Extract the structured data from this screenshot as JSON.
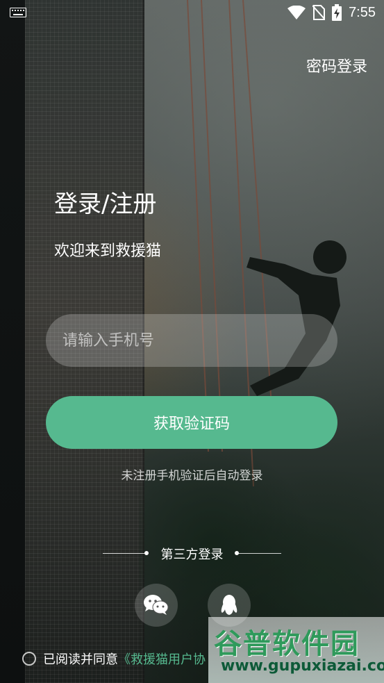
{
  "status_bar": {
    "time": "7:55"
  },
  "header": {
    "password_login": "密码登录"
  },
  "hero": {
    "title": "登录/注册",
    "subtitle": "欢迎来到救援猫"
  },
  "form": {
    "phone_placeholder": "请输入手机号",
    "get_code_label": "获取验证码",
    "hint": "未注册手机验证后自动登录"
  },
  "third_party": {
    "label": "第三方登录",
    "icons": [
      "wechat-icon",
      "qq-icon"
    ]
  },
  "agreement": {
    "prefix": "已阅读并同意",
    "link": "《救援猫用户协"
  },
  "watermark": {
    "title": "谷普软件园",
    "url": "www.gupuxiazai.com"
  },
  "colors": {
    "accent": "#56b98f"
  }
}
